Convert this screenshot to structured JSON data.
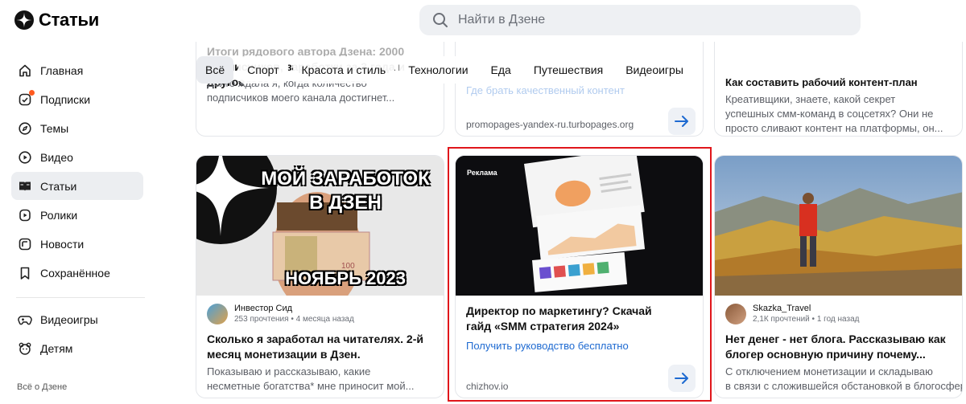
{
  "header": {
    "logo_text": "Статьи",
    "search_placeholder": "Найти в Дзене"
  },
  "sidebar": {
    "items": [
      {
        "label": "Главная",
        "icon": "home-icon"
      },
      {
        "label": "Подписки",
        "icon": "subscriptions-icon"
      },
      {
        "label": "Темы",
        "icon": "compass-icon"
      },
      {
        "label": "Видео",
        "icon": "video-icon"
      },
      {
        "label": "Статьи",
        "icon": "articles-icon",
        "active": true
      },
      {
        "label": "Ролики",
        "icon": "shorts-icon"
      },
      {
        "label": "Новости",
        "icon": "news-icon"
      },
      {
        "label": "Сохранённое",
        "icon": "bookmark-icon"
      },
      {
        "label": "Видеоигры",
        "icon": "gamepad-icon"
      },
      {
        "label": "Детям",
        "icon": "kids-icon"
      }
    ],
    "footer": "Всё о Дзене"
  },
  "chips": [
    "Всё",
    "Спорт",
    "Красота и стиль",
    "Технологии",
    "Еда",
    "Путешествия",
    "Видеоигры"
  ],
  "top_row": [
    {
      "title_lines": [
        "Итоги рядового автора Дзена: 2000",
        "подписчиков, заработки за 3 года и другое"
      ],
      "text_lines": [
        "Долго ждала я, когда количество",
        "подписчиков моего канала достигнет..."
      ]
    },
    {
      "link": "Где брать качественный контент",
      "domain": "promopages-yandex-ru.turbopages.org"
    },
    {
      "title": "Как составить рабочий контент-план",
      "text_lines": [
        "Креативщики, знаете, какой секрет",
        "успешных смм-команд в соцсетях? Они не",
        "просто сливают контент на платформы, он..."
      ]
    }
  ],
  "cards": [
    {
      "image_text": [
        "МОЙ ЗАРАБОТОК",
        "В ДЗЕН",
        "НОЯБРЬ 2023"
      ],
      "author": "Инвестор Сид",
      "meta": "253 прочтения • 4 месяца назад",
      "title_lines": [
        "Сколько я заработал на читателях. 2-й",
        "месяц монетизации в Дзен."
      ],
      "text_lines": [
        "Показываю и рассказываю, какие",
        "несметные богатства* мне приносит мой..."
      ]
    },
    {
      "badge": "Реклама",
      "title_lines": [
        "Директор по маркетингу? Скачай",
        "гайд «SMM стратегия 2024»"
      ],
      "link": "Получить руководство бесплатно",
      "domain": "chizhov.io"
    },
    {
      "author": "Skazka_Travel",
      "meta": "2,1К прочтений • 1 год назад",
      "title_lines": [
        "Нет денег - нет блога. Рассказываю как",
        "блогер основную причину почему..."
      ],
      "text_lines": [
        "С отключением монетизации и складываю",
        "в связи с сложившейся обстановкой в блогосфере..."
      ]
    }
  ],
  "colors": {
    "accent": "#1e6ad1",
    "ad_highlight": "#e0161b",
    "notification_dot": "#ff5a1f"
  }
}
